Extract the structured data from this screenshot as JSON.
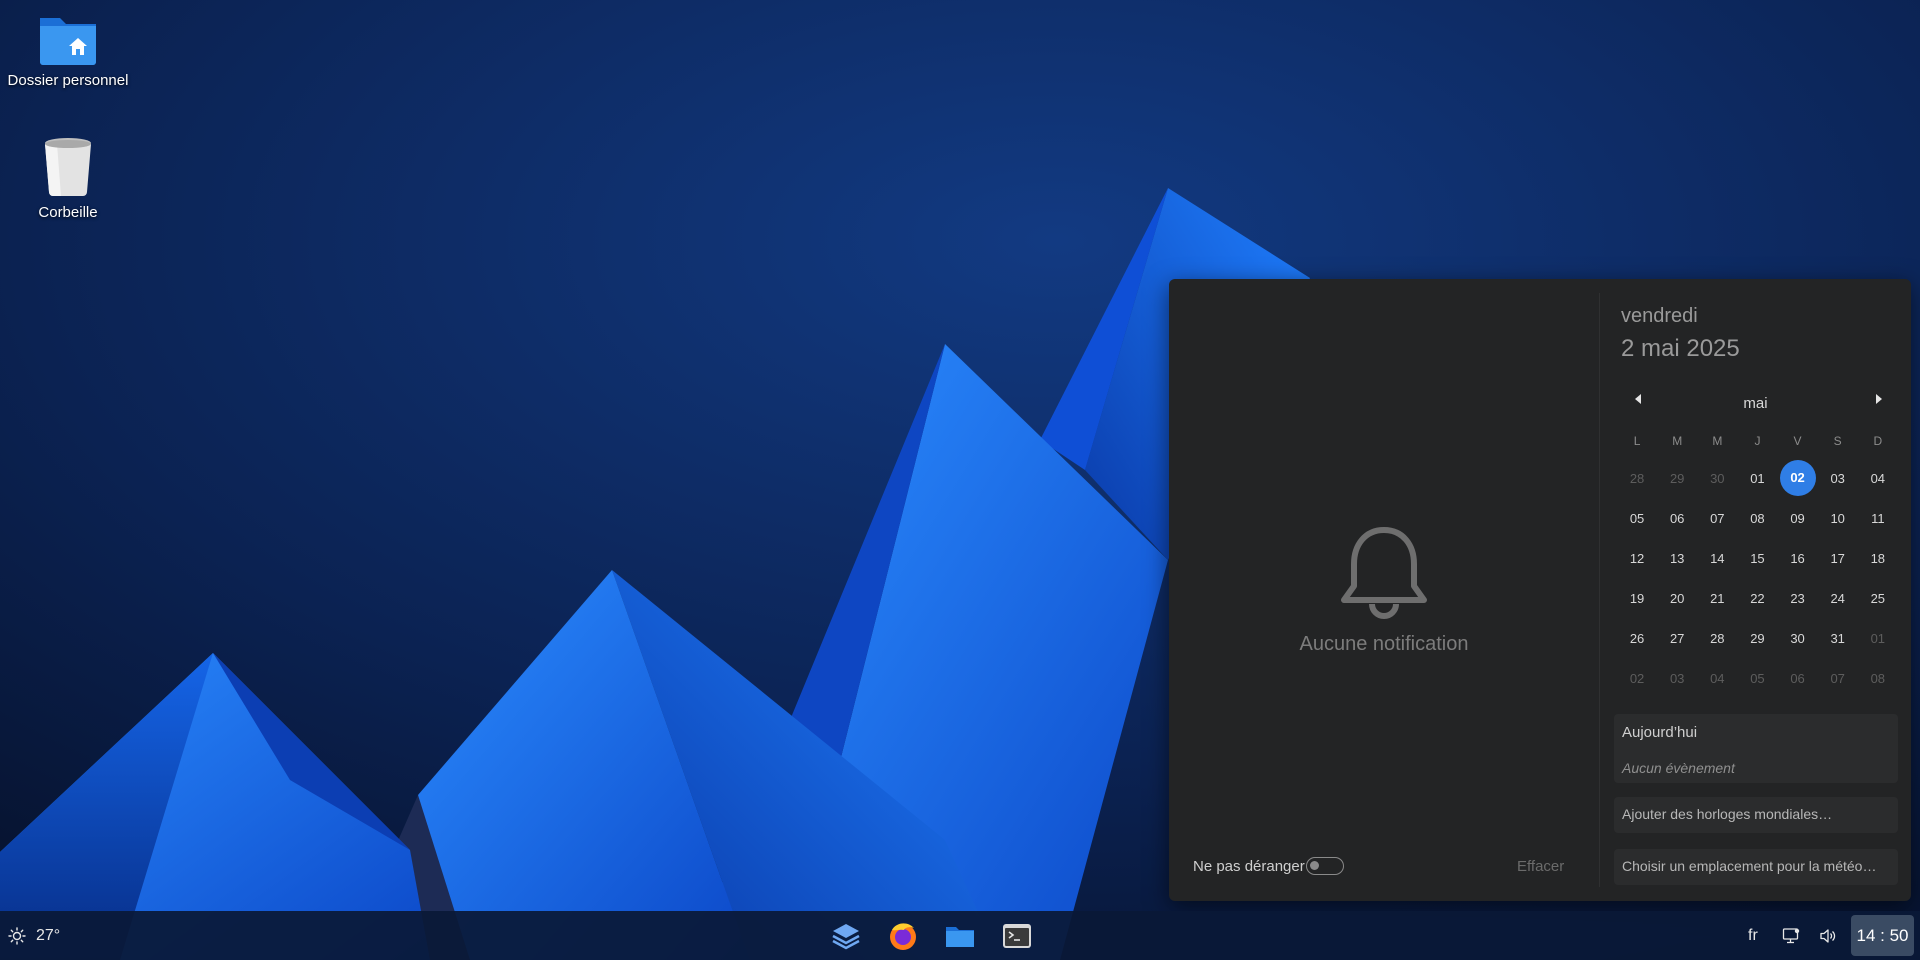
{
  "desktop": {
    "icons": [
      {
        "label": "Dossier personnel",
        "icon": "home-folder-icon"
      },
      {
        "label": "Corbeille",
        "icon": "trash-icon"
      }
    ]
  },
  "panel": {
    "notifications": {
      "empty_text": "Aucune notification",
      "dnd_label": "Ne pas déranger",
      "dnd_enabled": false,
      "clear_label": "Effacer"
    },
    "calendar": {
      "weekday": "vendredi",
      "date": "2 mai 2025",
      "month": "mai",
      "day_headers": [
        "L",
        "M",
        "M",
        "J",
        "V",
        "S",
        "D"
      ],
      "weeks": [
        [
          "28",
          "29",
          "30",
          "01",
          "02",
          "03",
          "04"
        ],
        [
          "05",
          "06",
          "07",
          "08",
          "09",
          "10",
          "11"
        ],
        [
          "12",
          "13",
          "14",
          "15",
          "16",
          "17",
          "18"
        ],
        [
          "19",
          "20",
          "21",
          "22",
          "23",
          "24",
          "25"
        ],
        [
          "26",
          "27",
          "28",
          "29",
          "30",
          "31",
          "01"
        ],
        [
          "02",
          "03",
          "04",
          "05",
          "06",
          "07",
          "08"
        ]
      ],
      "selected_day": "02",
      "today_title": "Aujourd’hui",
      "no_events": "Aucun évènement",
      "add_clocks": "Ajouter des horloges mondiales…",
      "choose_weather": "Choisir un emplacement pour la météo…"
    }
  },
  "taskbar": {
    "temperature": "27°",
    "weather_icon": "sun-icon",
    "apps": [
      "layers-icon",
      "firefox-icon",
      "files-icon",
      "terminal-icon"
    ],
    "language": "fr",
    "clock": "14 : 50"
  },
  "colors": {
    "accent": "#2f7ee6",
    "panel_bg": "#232425",
    "taskbar_bg": "#0a1937"
  }
}
